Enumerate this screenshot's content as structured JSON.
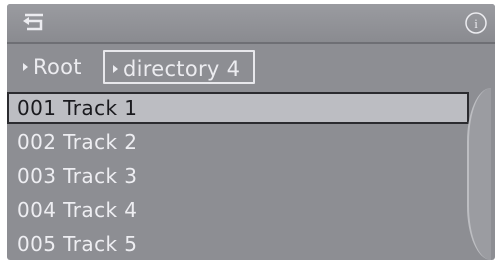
{
  "topbar": {
    "back_icon": "back-arrow-icon",
    "info_icon": "info-icon",
    "info_glyph": "i"
  },
  "breadcrumb": {
    "root_label": "Root",
    "current_label": "directory 4"
  },
  "tracks": [
    {
      "label": "001 Track  1",
      "selected": true
    },
    {
      "label": "002 Track  2",
      "selected": false
    },
    {
      "label": "003 Track  3",
      "selected": false
    },
    {
      "label": "004 Track  4",
      "selected": false
    },
    {
      "label": "005 Track  5",
      "selected": false
    }
  ],
  "colors": {
    "background": "#8d8e93",
    "selected_bg": "#bcbdc2",
    "text": "#eeeef2"
  }
}
